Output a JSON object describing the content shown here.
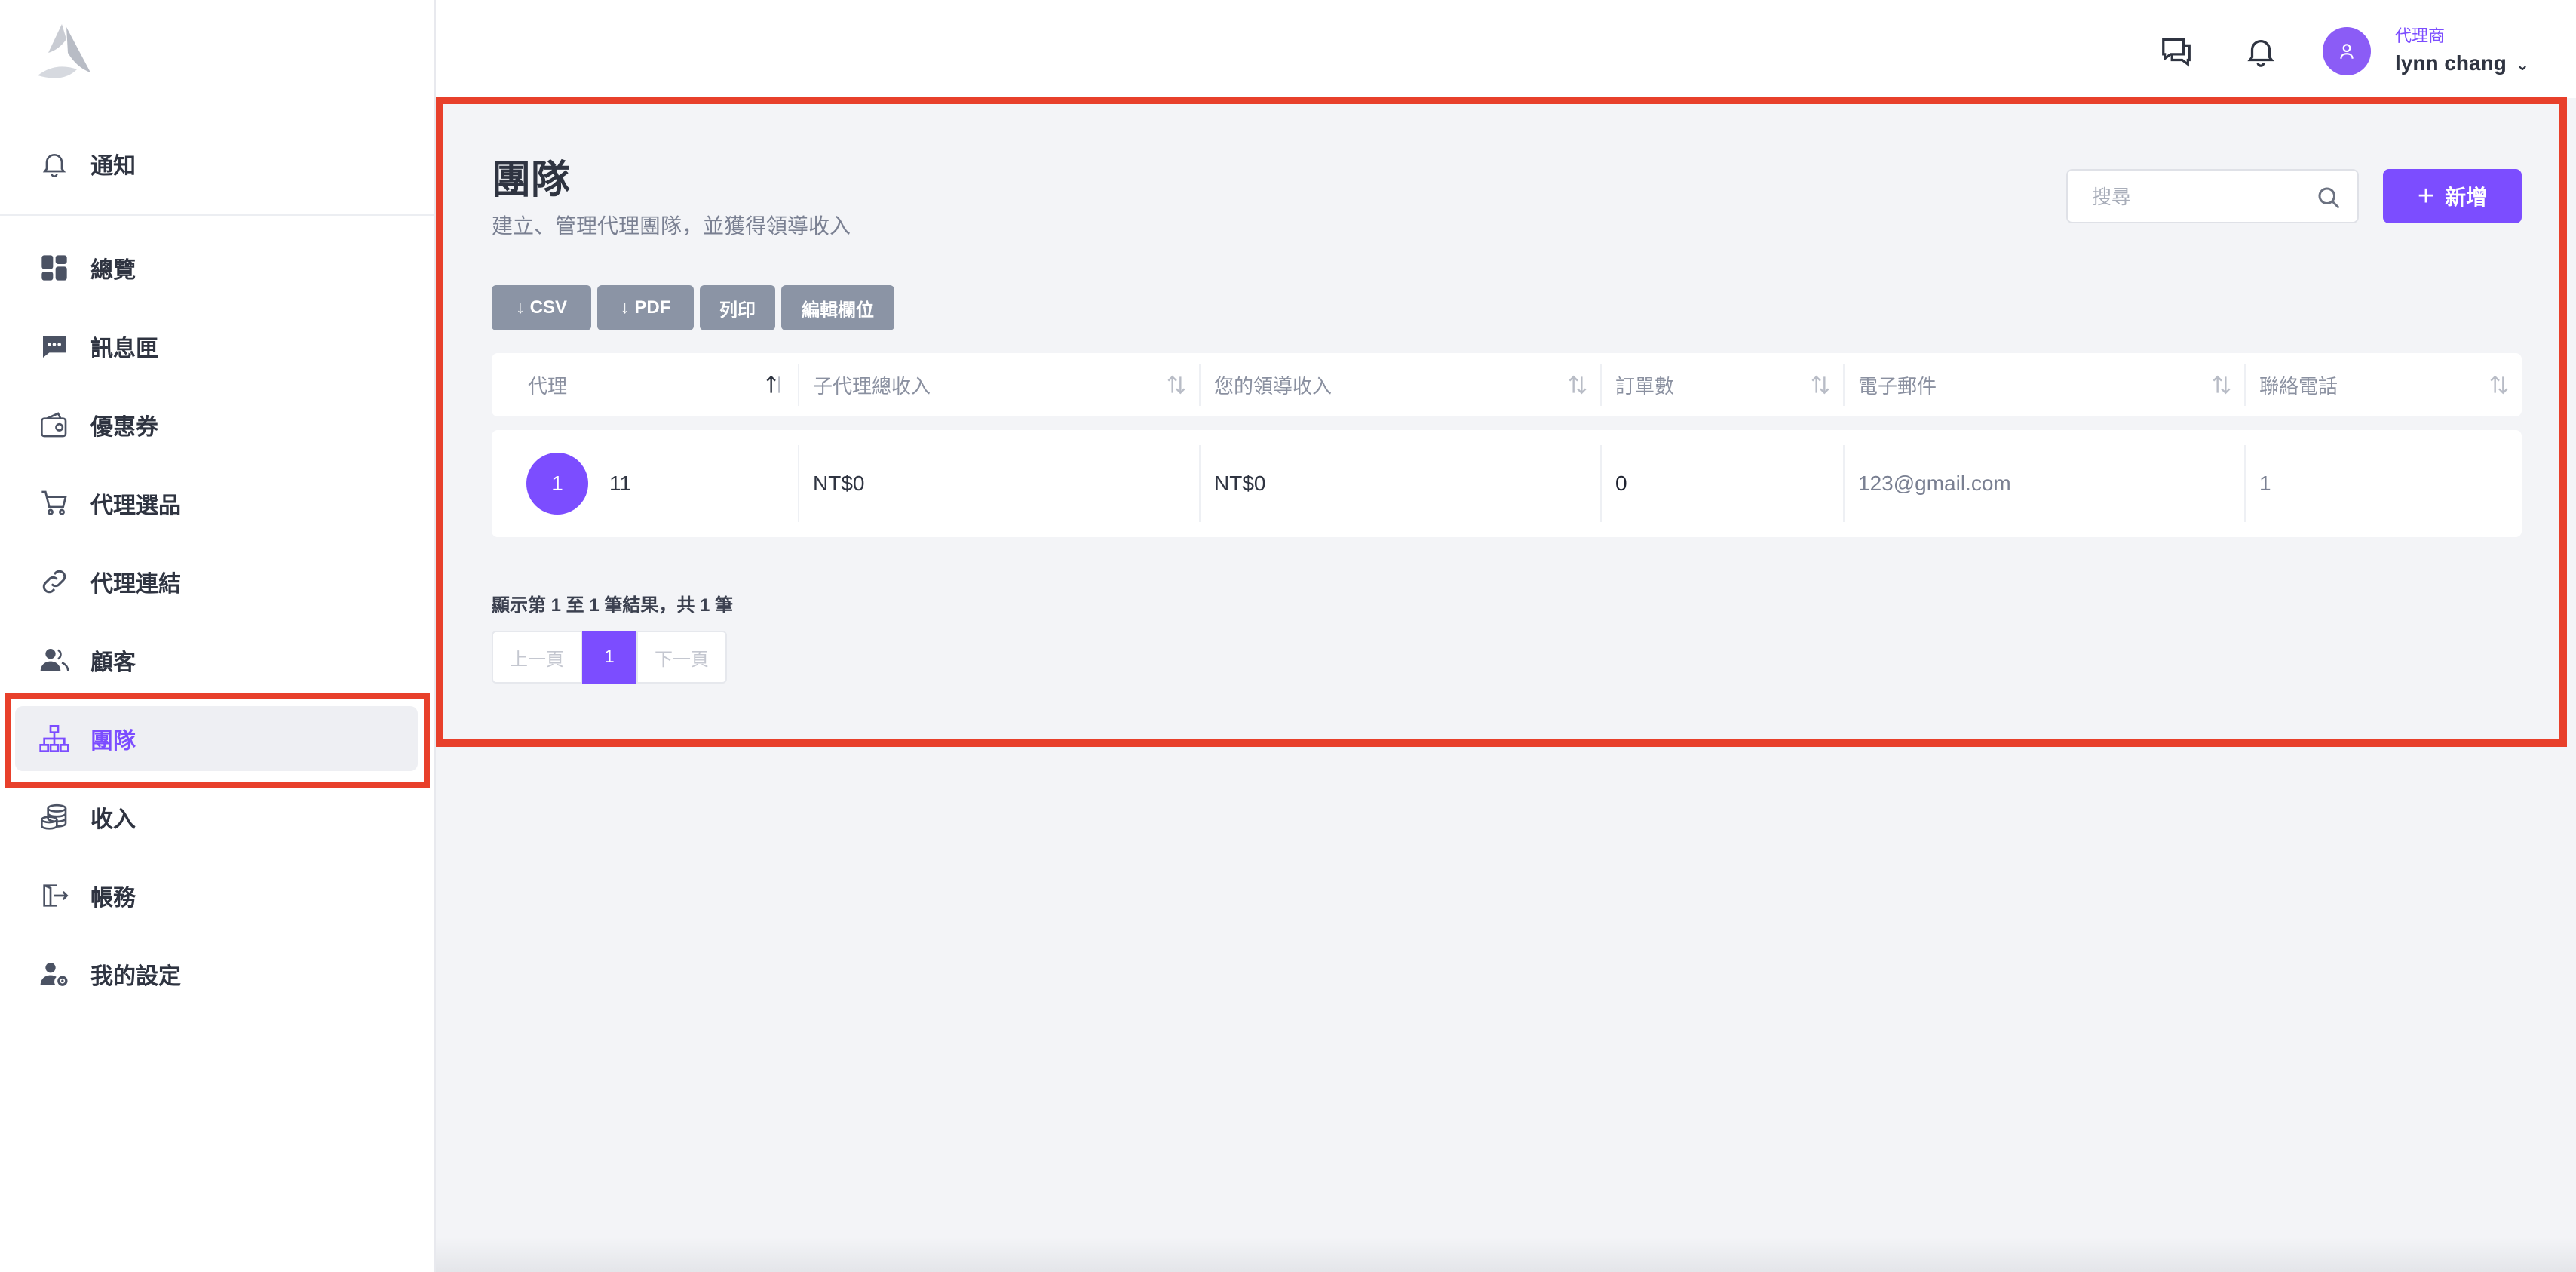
{
  "header": {
    "role": "代理商",
    "user_name": "lynn chang"
  },
  "sidebar": {
    "items": [
      {
        "label": "通知",
        "icon": "bell-icon"
      },
      {
        "label": "總覽",
        "icon": "dashboard-grid-icon"
      },
      {
        "label": "訊息匣",
        "icon": "chat-bubble-icon"
      },
      {
        "label": "優惠券",
        "icon": "coupon-wallet-icon"
      },
      {
        "label": "代理選品",
        "icon": "cart-icon"
      },
      {
        "label": "代理連結",
        "icon": "link-icon"
      },
      {
        "label": "顧客",
        "icon": "users-icon"
      },
      {
        "label": "團隊",
        "icon": "team-hierarchy-icon",
        "active": true
      },
      {
        "label": "收入",
        "icon": "coins-icon"
      },
      {
        "label": "帳務",
        "icon": "billing-export-icon"
      },
      {
        "label": "我的設定",
        "icon": "user-settings-icon"
      }
    ]
  },
  "page": {
    "title": "團隊",
    "subtitle": "建立、管理代理團隊，並獲得領導收入",
    "search_placeholder": "搜尋",
    "add_label": "新增"
  },
  "toolbar": {
    "csv": "↓ CSV",
    "pdf": "↓ PDF",
    "print": "列印",
    "edit_columns": "編輯欄位"
  },
  "table": {
    "columns": [
      "代理",
      "子代理總收入",
      "您的領導收入",
      "訂單數",
      "電子郵件",
      "聯絡電話"
    ],
    "rows": [
      {
        "avatar": "1",
        "agent": "11",
        "sub_income": "NT$0",
        "lead_income": "NT$0",
        "orders": "0",
        "email": "123@gmail.com",
        "phone": "1"
      }
    ]
  },
  "pagination": {
    "summary": "顯示第 1 至 1 筆結果，共 1 筆",
    "prev": "上一頁",
    "current": "1",
    "next": "下一頁"
  },
  "colors": {
    "accent": "#7c4dff",
    "highlight": "#e8402b"
  }
}
